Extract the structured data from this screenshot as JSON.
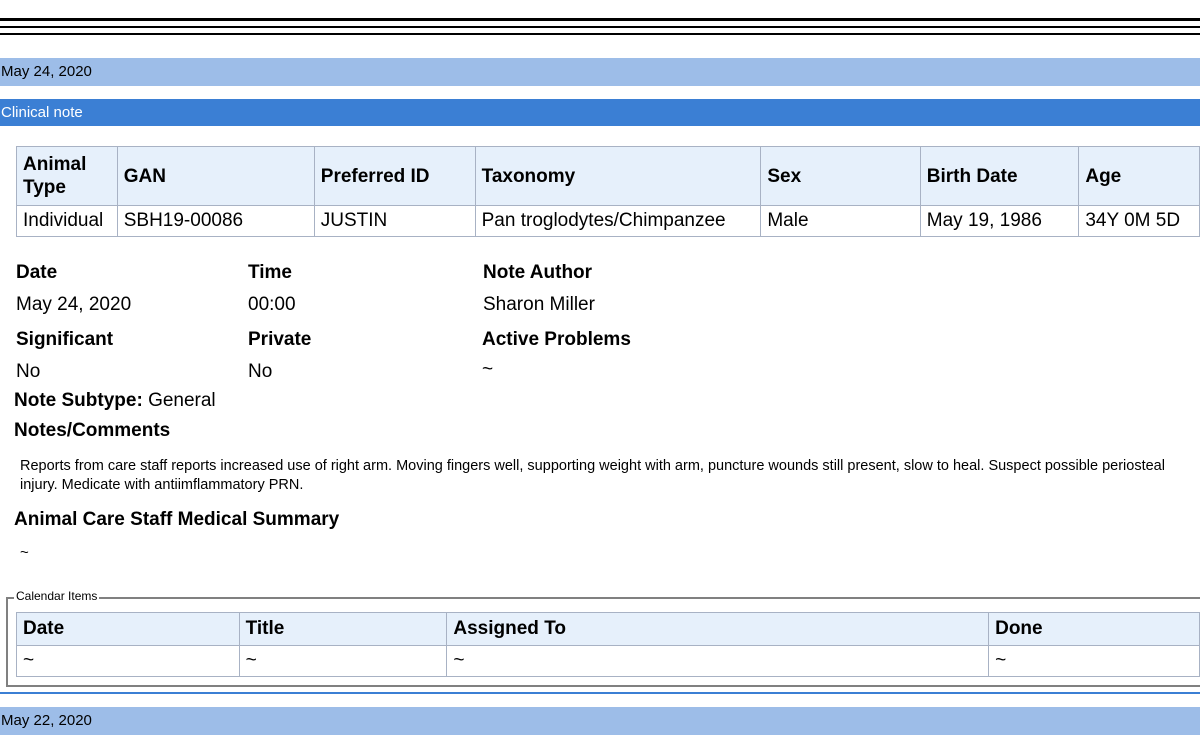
{
  "entries": [
    {
      "date": "May 24, 2020",
      "note_type": "Clinical note",
      "animal_table": {
        "headers": [
          "Animal Type",
          "GAN",
          "Preferred ID",
          "Taxonomy",
          "Sex",
          "Birth Date",
          "Age"
        ],
        "row": [
          "Individual",
          "SBH19-00086",
          "JUSTIN",
          "Pan troglodytes/Chimpanzee",
          "Male",
          "May 19, 1986",
          "34Y 0M 5D"
        ]
      },
      "details": {
        "date_label": "Date",
        "date_value": "May 24, 2020",
        "time_label": "Time",
        "time_value": "00:00",
        "author_label": "Note Author",
        "author_value": "Sharon Miller",
        "significant_label": "Significant",
        "significant_value": "No",
        "private_label": "Private",
        "private_value": "No",
        "active_problems_label": "Active Problems",
        "active_problems_value": "~",
        "subtype_label": "Note Subtype:",
        "subtype_value": "General"
      },
      "notes_heading": "Notes/Comments",
      "notes_text": "Reports from care staff reports increased use of right arm. Moving fingers well, supporting weight with arm, puncture wounds still present, slow to heal. Suspect possible periosteal injury. Medicate with antiimflammatory PRN.",
      "summary_heading": "Animal Care Staff Medical Summary",
      "summary_text": "~",
      "calendar": {
        "legend": "Calendar Items",
        "headers": [
          "Date",
          "Title",
          "Assigned To",
          "Done"
        ],
        "row": [
          "~",
          "~",
          "~",
          "~"
        ]
      }
    },
    {
      "date": "May 22, 2020"
    }
  ]
}
